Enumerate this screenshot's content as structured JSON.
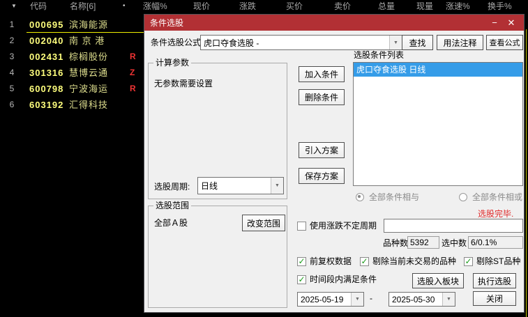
{
  "table": {
    "sort_icon": "▼",
    "header_dot": "•",
    "columns": [
      "代码",
      "名称[6]",
      "涨幅%",
      "现价",
      "涨跌",
      "买价",
      "卖价",
      "总量",
      "现量",
      "涨速%",
      "换手%"
    ],
    "rows": [
      {
        "num": "1",
        "code": "000695",
        "name": "滨海能源",
        "tag": ""
      },
      {
        "num": "2",
        "code": "002040",
        "name": "南 京 港",
        "tag": ""
      },
      {
        "num": "3",
        "code": "002431",
        "name": "棕榈股份",
        "tag": "R"
      },
      {
        "num": "4",
        "code": "301316",
        "name": "慧博云通",
        "tag": "Z"
      },
      {
        "num": "5",
        "code": "600798",
        "name": "宁波海运",
        "tag": "R"
      },
      {
        "num": "6",
        "code": "603192",
        "name": "汇得科技",
        "tag": ""
      }
    ]
  },
  "dialog": {
    "title": "条件选股",
    "minimize_icon": "−",
    "close_icon": "✕",
    "formula": {
      "label": "条件选股公式",
      "value": "虎口夺食选股 -"
    },
    "buttons": {
      "find": "查找",
      "usage": "用法注释",
      "view": "查看公式",
      "add": "加入条件",
      "del": "删除条件",
      "import": "引入方案",
      "save": "保存方案",
      "change_range": "改变范围",
      "to_block": "选股入板块",
      "execute": "执行选股",
      "close": "关闭"
    },
    "params_group": {
      "title": "计算参数",
      "empty_text": "无参数需要设置",
      "period_label": "选股周期:",
      "period_value": "日线"
    },
    "range_group": {
      "title": "选股范围",
      "value": "全部Ａ股"
    },
    "list": {
      "label": "选股条件列表",
      "items": [
        {
          "text": "虎口夺食选股  日线",
          "selected": true
        }
      ]
    },
    "radios": {
      "and_label": "全部条件相与",
      "or_label": "全部条件相或",
      "selected": "and"
    },
    "status_text": "选股完毕.",
    "checkboxes": {
      "variable_period": {
        "label": "使用涨跌不定周期",
        "checked": false
      },
      "forward_adjusted": {
        "label": "前复权数据",
        "checked": true
      },
      "exclude_untraded": {
        "label": "剔除当前未交易的品种",
        "checked": true
      },
      "exclude_st": {
        "label": "剔除ST品种",
        "checked": true
      },
      "time_range": {
        "label": "时间段内满足条件",
        "checked": true
      }
    },
    "variable_period_input": "",
    "counts": {
      "total_label": "品种数",
      "total_value": "5392",
      "selected_label": "选中数",
      "selected_value": "6/0.1%"
    },
    "dates": {
      "from": "2025-05-19",
      "separator": "-",
      "to": "2025-05-30"
    },
    "icons": {
      "check": "✓",
      "dropdown": "▼"
    },
    "colors": {
      "titlebar": "#b23034",
      "selection": "#359ce8",
      "status": "#e02b2b",
      "code": "#ffff7d",
      "name": "#dede8e",
      "tag": "#ee3333"
    }
  }
}
